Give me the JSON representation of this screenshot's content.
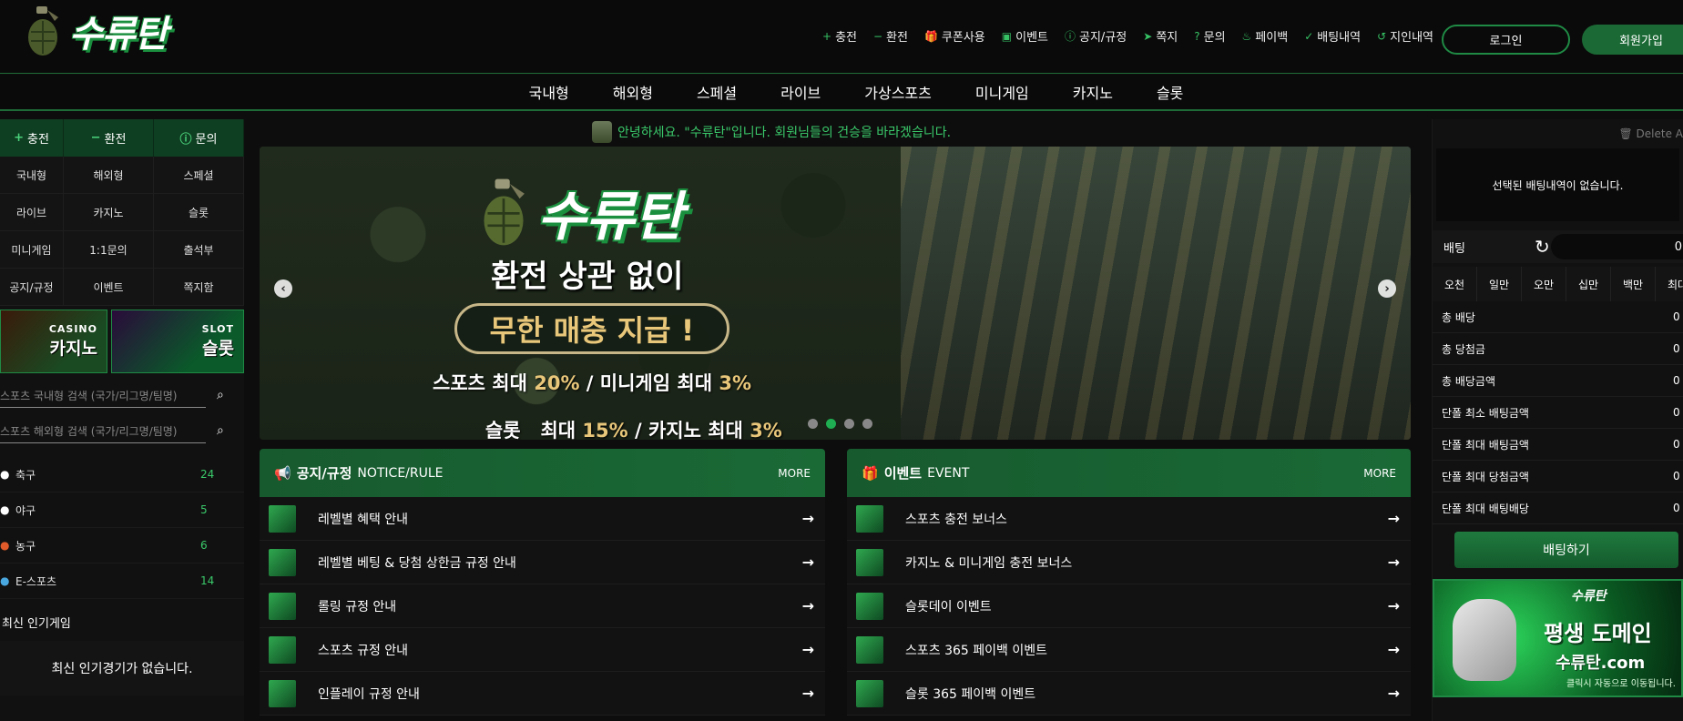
{
  "brand": {
    "name": "수류탄",
    "accent": "#1a8f3e"
  },
  "topnav": [
    {
      "icon": "plus-icon",
      "glyph": "+",
      "label": "충전"
    },
    {
      "icon": "minus-icon",
      "glyph": "−",
      "label": "환전"
    },
    {
      "icon": "gift-icon",
      "glyph": "🎁",
      "label": "쿠폰사용"
    },
    {
      "icon": "calendar-icon",
      "glyph": "▣",
      "label": "이벤트"
    },
    {
      "icon": "info-icon",
      "glyph": "ⓘ",
      "label": "공지/규정"
    },
    {
      "icon": "send-icon",
      "glyph": "➤",
      "label": "쪽지"
    },
    {
      "icon": "question-icon",
      "glyph": "?",
      "label": "문의"
    },
    {
      "icon": "payback-icon",
      "glyph": "♨",
      "label": "페이백"
    },
    {
      "icon": "check-icon",
      "glyph": "✓",
      "label": "배팅내역"
    },
    {
      "icon": "history-icon",
      "glyph": "↺",
      "label": "지인내역"
    }
  ],
  "auth": {
    "login": "로그인",
    "join": "회원가입"
  },
  "mainnav": [
    "국내형",
    "해외형",
    "스페셜",
    "라이브",
    "가상스포츠",
    "미니게임",
    "카지노",
    "슬롯"
  ],
  "left": {
    "quick": [
      {
        "icon": "plus-icon",
        "glyph": "+",
        "label": "충전"
      },
      {
        "icon": "minus-icon",
        "glyph": "−",
        "label": "환전"
      },
      {
        "icon": "info-icon",
        "glyph": "ⓘ",
        "label": "문의"
      }
    ],
    "menu": [
      "국내형",
      "해외형",
      "스페셜",
      "라이브",
      "카지노",
      "슬롯",
      "미니게임",
      "1:1문의",
      "출석부",
      "공지/규정",
      "이벤트",
      "쪽지함"
    ],
    "promos": [
      {
        "sub": "CASINO",
        "main": "카지노"
      },
      {
        "sub": "SLOT",
        "main": "슬롯"
      }
    ],
    "search": [
      "스포츠 국내형 검색 (국가/리그명/팀명)",
      "스포츠 해외형 검색 (국가/리그명/팀명)"
    ],
    "sports": [
      {
        "name": "축구",
        "count": "24",
        "color": "#ffffff"
      },
      {
        "name": "야구",
        "count": "5",
        "color": "#ffffff"
      },
      {
        "name": "농구",
        "count": "6",
        "color": "#e05a2a"
      },
      {
        "name": "E-스포츠",
        "count": "14",
        "color": "#4aa8e0"
      }
    ],
    "popular_title": "최신 인기게임",
    "popular_empty": "최신 인기경기가 없습니다."
  },
  "notice": "안녕하세요. \"수류탄\"입니다. 회원님들의 건승을 바라겠습니다.",
  "banner": {
    "logo": "수류탄",
    "headline": "환전 상관 없이",
    "pill": "무한 매충 지급 !",
    "line1": {
      "a": "스포츠 최대 ",
      "b": "20%",
      "c": " / 미니게임 최대 ",
      "d": "3%"
    },
    "line2": {
      "a": "슬롯   최대 ",
      "b": "15%",
      "c": " / 카지노 최대 ",
      "d": "3%"
    },
    "active_dot": 1
  },
  "panels": [
    {
      "title": "공지/규정",
      "sub": "NOTICE/RULE",
      "more": "MORE",
      "icon": "megaphone-icon",
      "rows": [
        "레벨별 혜택 안내",
        "레벨별 베팅 & 당첨 상한금 규정 안내",
        "롤링 규정 안내",
        "스포츠 규정 안내",
        "인플레이 규정 안내"
      ]
    },
    {
      "title": "이벤트",
      "sub": "EVENT",
      "more": "MORE",
      "icon": "gift-icon",
      "rows": [
        "스포츠 충전 보너스",
        "카지노 & 미니게임 충전 보너스",
        "슬롯데이 이벤트",
        "스포츠 365 페이백 이벤트",
        "슬롯 365 페이백 이벤트"
      ]
    }
  ],
  "right": {
    "delete": "Delete A",
    "empty": "선택된 배팅내역이 없습니다.",
    "bet_label": "배팅",
    "bet_value": "0",
    "amounts": [
      "오천",
      "일만",
      "오만",
      "십만",
      "백만",
      "최대"
    ],
    "stats": [
      {
        "label": "총 배당",
        "value": "0"
      },
      {
        "label": "총 당첨금",
        "value": "0"
      },
      {
        "label": "총 배당금액",
        "value": "0"
      },
      {
        "label": "단폴 최소 배팅금액",
        "value": "0"
      },
      {
        "label": "단폴 최대 배팅금액",
        "value": "0"
      },
      {
        "label": "단폴 최대 당첨금액",
        "value": "0"
      },
      {
        "label": "단폴 최대 배팅배당",
        "value": "0"
      }
    ],
    "bet_button": "배팅하기",
    "promo": {
      "logo": "수류탄",
      "main": "평생 도메인",
      "url": "수류탄.com",
      "note": "클릭시 자동으로 이동됩니다."
    }
  }
}
